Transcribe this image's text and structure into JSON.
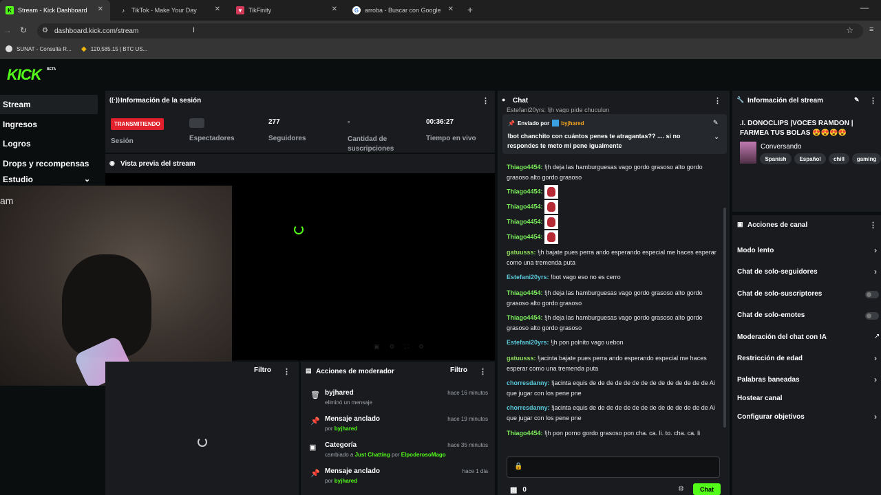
{
  "browser": {
    "tabs": [
      {
        "label": "Stream - Kick Dashboard"
      },
      {
        "label": "TikTok - Make Your Day"
      },
      {
        "label": "TikFinity"
      },
      {
        "label": "arroba - Buscar con Google"
      }
    ],
    "url": "dashboard.kick.com/stream",
    "bookmarks": [
      {
        "label": "SUNAT - Consulta R..."
      },
      {
        "label": "120,585.15 | BTC US..."
      }
    ]
  },
  "brand": {
    "logo": "KICK",
    "beta": "BETA",
    "color": "#53fc18"
  },
  "sidebar": {
    "items": [
      {
        "label": "Stream"
      },
      {
        "label": "Ingresos"
      },
      {
        "label": "Logros"
      },
      {
        "label": "Drops y recompensas"
      },
      {
        "label": "Estudio"
      }
    ]
  },
  "session": {
    "title": "Información de la sesión",
    "status_badge": "TRANSMITIENDO",
    "status_label": "Sesión",
    "viewers_label": "Espectadores",
    "followers_value": "277",
    "followers_label": "Seguidores",
    "subs_value": "-",
    "subs_label": "Cantidad de suscripciones",
    "time_value": "00:36:27",
    "time_label": "Tiempo en vivo"
  },
  "preview": {
    "title": "Vista previa del stream",
    "webcam_text": "am"
  },
  "lower_left": {
    "filter_label": "Filtro"
  },
  "mod_actions": {
    "title": "Acciones de moderador",
    "filter_label": "Filtro",
    "items": [
      {
        "title": "byjhared",
        "sub": "eliminó un mensaje",
        "time": "hace 16 minutos"
      },
      {
        "title": "Mensaje anclado",
        "sub_prefix": "por",
        "sub_user": "byjhared",
        "time": "hace 19 minutos"
      },
      {
        "title": "Categoría",
        "sub_prefix": "cambiado a",
        "sub_link": "Just Chatting",
        "sub_mid": "por",
        "sub_user": "ElpoderosoMago",
        "time": "hace 35 minutos"
      },
      {
        "title": "Mensaje anclado",
        "sub_prefix": "por",
        "sub_user": "byjhared",
        "time": "hace 1 día"
      }
    ]
  },
  "chat": {
    "title": "Chat",
    "top_cut": "Estefani20yrs: !jh vago pide chuculun",
    "pinned": {
      "label": "Enviado por",
      "user": "byjhared",
      "text": "!bot chanchito con cuántos penes te atragantas?? .... si no respondes te meto mi pene igualmente"
    },
    "messages": [
      {
        "user": "Thiago4454:",
        "text": "!jh deja las hamburguesas vago gordo grasoso alto gordo grasoso alto gordo grasoso",
        "color": "#7cf05a"
      },
      {
        "user": "Thiago4454:",
        "text": "",
        "emote": true,
        "color": "#7cf05a"
      },
      {
        "user": "Thiago4454:",
        "text": "",
        "emote": true,
        "color": "#7cf05a"
      },
      {
        "user": "Thiago4454:",
        "text": "",
        "emote": true,
        "color": "#7cf05a"
      },
      {
        "user": "Thiago4454:",
        "text": "",
        "emote": true,
        "color": "#7cf05a"
      },
      {
        "user": "gatuusss:",
        "text": "!jh bajate pues perra ando esperando especial me haces esperar como una tremenda puta",
        "color": "#8fdc5a"
      },
      {
        "user": "Estefani20yrs:",
        "text": "!bot vago eso no es cerro",
        "color": "#5ac8d8"
      },
      {
        "user": "Thiago4454:",
        "text": "!jh deja las hamburguesas vago gordo grasoso alto gordo grasoso alto gordo grasoso",
        "color": "#7cf05a"
      },
      {
        "user": "Thiago4454:",
        "text": "!jh deja las hamburguesas vago gordo grasoso alto gordo grasoso alto gordo grasoso",
        "color": "#7cf05a"
      },
      {
        "user": "Estefani20yrs:",
        "text": "!jh pon polnito vago uebon",
        "color": "#5ac8d8"
      },
      {
        "user": "gatuusss:",
        "text": "!jacinta bajate pues perra ando esperando especial me haces esperar como una tremenda puta",
        "color": "#8fdc5a"
      },
      {
        "user": "chorresdanny:",
        "text": "!jacinta equis de de de de de de de de de de de de de de Ai que jugar con los pene pne",
        "color": "#5ac8d8"
      },
      {
        "user": "chorresdanny:",
        "text": "!jacinta equis de de de de de de de de de de de de de de Ai que jugar con los pene pne",
        "color": "#5ac8d8"
      },
      {
        "user": "Thiago4454:",
        "text": "!jh pon porno gordo grasoso pon cha. ca. li. to. cha. ca. li",
        "color": "#7cf05a"
      }
    ],
    "points": "0",
    "send_label": "Chat"
  },
  "stream_info": {
    "title_header": "Información del stream",
    "stream_title": ".I. DONOCLIPS |VOCES RAMDON | FARMEA TUS BOLAS 😍😍😍😍",
    "category": "Conversando",
    "tags": [
      "Spanish",
      "Español",
      "chill",
      "gaming"
    ]
  },
  "channel_actions": {
    "title": "Acciones de canal",
    "items": [
      {
        "label": "Modo lento"
      },
      {
        "label": "Chat de solo-seguidores"
      },
      {
        "label": "Chat de solo-suscriptores"
      },
      {
        "label": "Chat de solo-emotes"
      },
      {
        "label": "Moderación del chat con IA"
      },
      {
        "label": "Restricción de edad"
      },
      {
        "label": "Palabras baneadas"
      },
      {
        "label": "Hostear canal"
      },
      {
        "label": "Configurar objetivos"
      }
    ]
  },
  "colors": {
    "accent": "#53fc18",
    "live_red": "#e0202a",
    "panel": "#191b1f",
    "background": "#0b0e0f"
  }
}
